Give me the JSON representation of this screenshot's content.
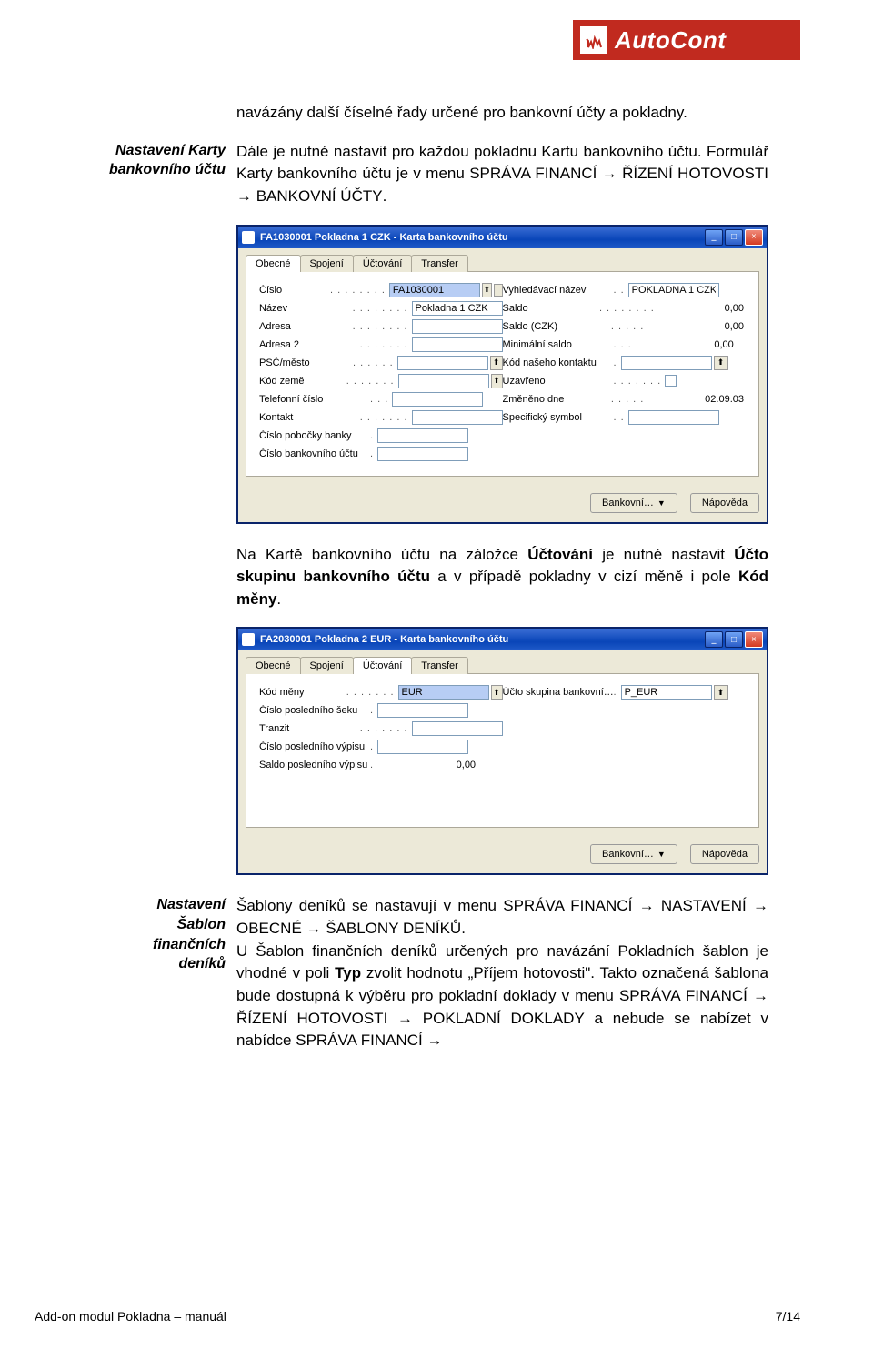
{
  "header": {
    "logo_text": "AutoCont"
  },
  "section1": {
    "side": "Nastavení Karty bankovního účtu",
    "p0": "navázány další číselné řady určené pro bankovní účty a pokladny.",
    "p1_a": "Dále je nutné nastavit pro každou pokladnu Kartu bankovního účtu. Formulář Karty bankovního účtu je v menu ",
    "p1_sc1": "SPRÁVA FINANCÍ → ŘÍZENÍ HOTOVOSTI → BANKOVNÍ ÚČTY",
    "p1_b": "."
  },
  "win1": {
    "title": "FA1030001 Pokladna 1 CZK - Karta bankovního účtu",
    "tabs": [
      "Obecné",
      "Spojení",
      "Účtování",
      "Transfer"
    ],
    "active_tab": 0,
    "left_fields": [
      {
        "label": "Číslo",
        "value": "FA1030001",
        "hl": true,
        "drop": true,
        "pencil": true
      },
      {
        "label": "Název",
        "value": "Pokladna 1 CZK"
      },
      {
        "label": "Adresa",
        "value": ""
      },
      {
        "label": "Adresa 2",
        "value": ""
      },
      {
        "label": "PSČ/město",
        "value": "",
        "drop": true
      },
      {
        "label": "Kód země",
        "value": "",
        "drop": true
      },
      {
        "label": "Telefonní číslo",
        "value": ""
      },
      {
        "label": "Kontakt",
        "value": ""
      },
      {
        "label": "Číslo pobočky banky",
        "value": ""
      },
      {
        "label": "Číslo bankovního účtu",
        "value": ""
      }
    ],
    "right_fields": [
      {
        "label": "Vyhledávací název",
        "value": "POKLADNA 1 CZK"
      },
      {
        "label": "Saldo",
        "value": "0,00",
        "ro": true
      },
      {
        "label": "Saldo (CZK)",
        "value": "0,00",
        "ro": true
      },
      {
        "label": "Minimální saldo",
        "value": "0,00",
        "ro": true
      },
      {
        "label": "Kód našeho kontaktu",
        "value": "",
        "drop": true
      },
      {
        "label": "Uzavřeno",
        "value": "",
        "check": true
      },
      {
        "label": "Změněno dne",
        "value": "02.09.03",
        "ro": true
      },
      {
        "label": "Specifický symbol",
        "value": ""
      }
    ],
    "buttons": [
      "Bankovní…",
      "Nápověda"
    ]
  },
  "mid": {
    "p_a": "Na Kartě bankovního účtu na záložce ",
    "bold1": "Účtování",
    "p_b": " je nutné nastavit ",
    "bold2": "Účto skupinu bankovního účtu",
    "p_c": " a v případě pokladny v cizí měně i pole ",
    "bold3": "Kód měny",
    "p_d": "."
  },
  "win2": {
    "title": "FA2030001 Pokladna 2 EUR - Karta bankovního účtu",
    "tabs": [
      "Obecné",
      "Spojení",
      "Účtování",
      "Transfer"
    ],
    "active_tab": 2,
    "left_fields": [
      {
        "label": "Kód měny",
        "value": "EUR",
        "hl": true,
        "drop": true
      },
      {
        "label": "Číslo posledního šeku",
        "value": ""
      },
      {
        "label": "Tranzit",
        "value": ""
      },
      {
        "label": "Číslo posledního výpisu",
        "value": ""
      },
      {
        "label": "Saldo posledního výpisu",
        "value": "0,00",
        "ro": true
      }
    ],
    "right_fields": [
      {
        "label": "Účto skupina bankovní…",
        "value": "P_EUR",
        "drop": true
      }
    ],
    "buttons": [
      "Bankovní…",
      "Nápověda"
    ]
  },
  "section2": {
    "side": "Nastavení Šablon finančních deníků",
    "p1_a": "Šablony deníků se nastavují v menu ",
    "p1_sc1": "SPRÁVA FINANCÍ → NASTAVENÍ → OBECNÉ → ŠABLONY DENÍKŮ",
    "p1_b": ".",
    "p2_a": "U Šablon finančních deníků určených pro navázání Pokladních šablon je vhodné v poli ",
    "p2_bold1": "Typ",
    "p2_b": " zvolit hodnotu „Příjem hotovosti\". Takto označená šablona bude dostupná k výběru pro pokladní doklady v menu ",
    "p2_sc1": "SPRÁVA FINANCÍ → ŘÍZENÍ HOTOVOSTI → POKLADNÍ DOKLADY",
    "p2_c": " a nebude se nabízet v nabídce ",
    "p2_sc2": "SPRÁVA FINANCÍ →"
  },
  "footer": {
    "left": "Add-on modul Pokladna – manuál",
    "right": "7/14"
  }
}
